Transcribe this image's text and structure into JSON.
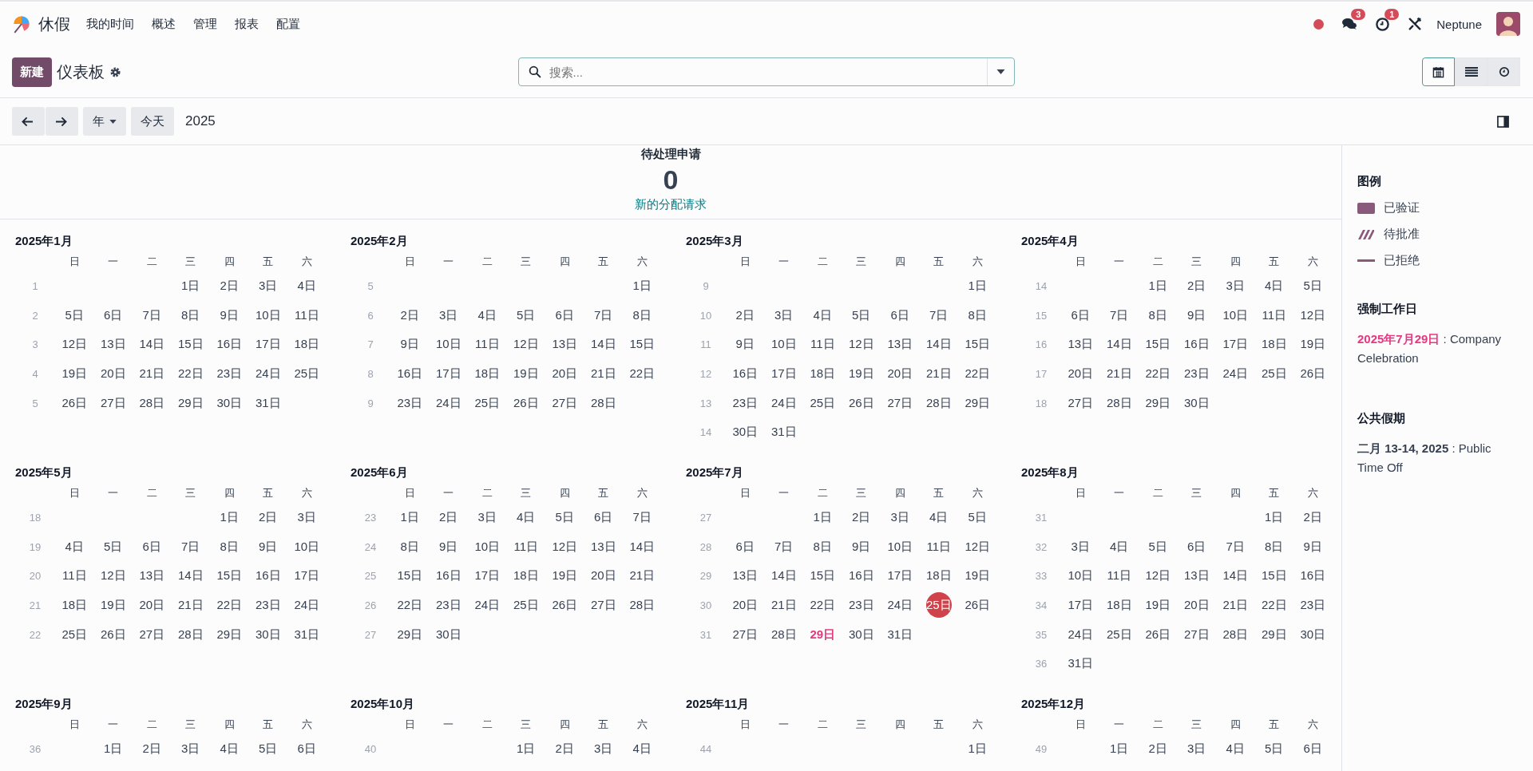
{
  "navbar": {
    "app_name": "休假",
    "menu": [
      "我的时间",
      "概述",
      "管理",
      "报表",
      "配置"
    ],
    "messages_badge": "3",
    "activities_badge": "1",
    "user_name": "Neptune"
  },
  "control_panel": {
    "new_button": "新建",
    "title": "仪表板",
    "search": {
      "placeholder": "搜索..."
    },
    "views": [
      {
        "kind": "calendar",
        "selected": true
      },
      {
        "kind": "list",
        "selected": false
      },
      {
        "kind": "activity",
        "selected": false
      }
    ]
  },
  "calendar_toolbar": {
    "scale": "年",
    "today_button": "今天",
    "period": "2025"
  },
  "pending": {
    "title": "待处理申请",
    "count": "0",
    "link": "新的分配请求"
  },
  "months": [
    {
      "title": "2025年1月",
      "weekdays": [
        "日",
        "一",
        "二",
        "三",
        "四",
        "五",
        "六"
      ],
      "weeks": [
        {
          "number": "1",
          "kind": "first",
          "days": [
            "1日",
            "2日",
            "3日",
            "4日"
          ]
        },
        {
          "number": "2",
          "kind": "full",
          "days": [
            "5日",
            "6日",
            "7日",
            "8日",
            "9日",
            "10日",
            "11日"
          ]
        },
        {
          "number": "3",
          "kind": "full",
          "days": [
            "12日",
            "13日",
            "14日",
            "15日",
            "16日",
            "17日",
            "18日"
          ]
        },
        {
          "number": "4",
          "kind": "full",
          "days": [
            "19日",
            "20日",
            "21日",
            "22日",
            "23日",
            "24日",
            "25日"
          ]
        },
        {
          "number": "5",
          "kind": "last",
          "days": [
            "26日",
            "27日",
            "28日",
            "29日",
            "30日",
            "31日"
          ]
        }
      ]
    },
    {
      "title": "2025年2月",
      "weekdays": [
        "日",
        "一",
        "二",
        "三",
        "四",
        "五",
        "六"
      ],
      "weeks": [
        {
          "number": "5",
          "kind": "first",
          "days": [
            "1日"
          ]
        },
        {
          "number": "6",
          "kind": "full",
          "days": [
            "2日",
            "3日",
            "4日",
            "5日",
            "6日",
            "7日",
            "8日"
          ]
        },
        {
          "number": "7",
          "kind": "full",
          "days": [
            "9日",
            "10日",
            "11日",
            "12日",
            "13日",
            "14日",
            "15日"
          ]
        },
        {
          "number": "8",
          "kind": "full",
          "days": [
            "16日",
            "17日",
            "18日",
            "19日",
            "20日",
            "21日",
            "22日"
          ]
        },
        {
          "number": "9",
          "kind": "last",
          "days": [
            "23日",
            "24日",
            "25日",
            "26日",
            "27日",
            "28日"
          ]
        }
      ]
    },
    {
      "title": "2025年3月",
      "weekdays": [
        "日",
        "一",
        "二",
        "三",
        "四",
        "五",
        "六"
      ],
      "weeks": [
        {
          "number": "9",
          "kind": "first",
          "days": [
            "1日"
          ]
        },
        {
          "number": "10",
          "kind": "full",
          "days": [
            "2日",
            "3日",
            "4日",
            "5日",
            "6日",
            "7日",
            "8日"
          ]
        },
        {
          "number": "11",
          "kind": "full",
          "days": [
            "9日",
            "10日",
            "11日",
            "12日",
            "13日",
            "14日",
            "15日"
          ]
        },
        {
          "number": "12",
          "kind": "full",
          "days": [
            "16日",
            "17日",
            "18日",
            "19日",
            "20日",
            "21日",
            "22日"
          ]
        },
        {
          "number": "13",
          "kind": "full",
          "days": [
            "23日",
            "24日",
            "25日",
            "26日",
            "27日",
            "28日",
            "29日"
          ]
        },
        {
          "number": "14",
          "kind": "last",
          "days": [
            "30日",
            "31日"
          ]
        }
      ]
    },
    {
      "title": "2025年4月",
      "weekdays": [
        "日",
        "一",
        "二",
        "三",
        "四",
        "五",
        "六"
      ],
      "weeks": [
        {
          "number": "14",
          "kind": "first",
          "days": [
            "1日",
            "2日",
            "3日",
            "4日",
            "5日"
          ]
        },
        {
          "number": "15",
          "kind": "full",
          "days": [
            "6日",
            "7日",
            "8日",
            "9日",
            "10日",
            "11日",
            "12日"
          ]
        },
        {
          "number": "16",
          "kind": "full",
          "days": [
            "13日",
            "14日",
            "15日",
            "16日",
            "17日",
            "18日",
            "19日"
          ]
        },
        {
          "number": "17",
          "kind": "full",
          "days": [
            "20日",
            "21日",
            "22日",
            "23日",
            "24日",
            "25日",
            "26日"
          ]
        },
        {
          "number": "18",
          "kind": "last",
          "days": [
            "27日",
            "28日",
            "29日",
            "30日"
          ]
        }
      ]
    },
    {
      "title": "2025年5月",
      "weekdays": [
        "日",
        "一",
        "二",
        "三",
        "四",
        "五",
        "六"
      ],
      "weeks": [
        {
          "number": "18",
          "kind": "first",
          "days": [
            "1日",
            "2日",
            "3日"
          ]
        },
        {
          "number": "19",
          "kind": "full",
          "days": [
            "4日",
            "5日",
            "6日",
            "7日",
            "8日",
            "9日",
            "10日"
          ]
        },
        {
          "number": "20",
          "kind": "full",
          "days": [
            "11日",
            "12日",
            "13日",
            "14日",
            "15日",
            "16日",
            "17日"
          ]
        },
        {
          "number": "21",
          "kind": "full",
          "days": [
            "18日",
            "19日",
            "20日",
            "21日",
            "22日",
            "23日",
            "24日"
          ]
        },
        {
          "number": "22",
          "kind": "full",
          "days": [
            "25日",
            "26日",
            "27日",
            "28日",
            "29日",
            "30日",
            "31日"
          ]
        }
      ]
    },
    {
      "title": "2025年6月",
      "weekdays": [
        "日",
        "一",
        "二",
        "三",
        "四",
        "五",
        "六"
      ],
      "weeks": [
        {
          "number": "23",
          "kind": "full",
          "days": [
            "1日",
            "2日",
            "3日",
            "4日",
            "5日",
            "6日",
            "7日"
          ]
        },
        {
          "number": "24",
          "kind": "full",
          "days": [
            "8日",
            "9日",
            "10日",
            "11日",
            "12日",
            "13日",
            "14日"
          ]
        },
        {
          "number": "25",
          "kind": "full",
          "days": [
            "15日",
            "16日",
            "17日",
            "18日",
            "19日",
            "20日",
            "21日"
          ]
        },
        {
          "number": "26",
          "kind": "full",
          "days": [
            "22日",
            "23日",
            "24日",
            "25日",
            "26日",
            "27日",
            "28日"
          ]
        },
        {
          "number": "27",
          "kind": "last",
          "days": [
            "29日",
            "30日"
          ]
        }
      ]
    },
    {
      "title": "2025年7月",
      "weekdays": [
        "日",
        "一",
        "二",
        "三",
        "四",
        "五",
        "六"
      ],
      "weeks": [
        {
          "number": "27",
          "kind": "first",
          "days": [
            "1日",
            "2日",
            "3日",
            "4日",
            "5日"
          ]
        },
        {
          "number": "28",
          "kind": "full",
          "days": [
            "6日",
            "7日",
            "8日",
            "9日",
            "10日",
            "11日",
            "12日"
          ]
        },
        {
          "number": "29",
          "kind": "full",
          "days": [
            "13日",
            "14日",
            "15日",
            "16日",
            "17日",
            "18日",
            "19日"
          ]
        },
        {
          "number": "30",
          "kind": "full",
          "days": [
            "20日",
            "21日",
            "22日",
            "23日",
            "24日",
            {
              "text": "25日",
              "kind": "today"
            },
            "26日"
          ]
        },
        {
          "number": "31",
          "kind": "last",
          "days": [
            "27日",
            "28日",
            {
              "text": "29日",
              "kind": "mandatory"
            },
            "30日",
            "31日"
          ]
        }
      ]
    },
    {
      "title": "2025年8月",
      "weekdays": [
        "日",
        "一",
        "二",
        "三",
        "四",
        "五",
        "六"
      ],
      "weeks": [
        {
          "number": "31",
          "kind": "first",
          "days": [
            "1日",
            "2日"
          ]
        },
        {
          "number": "32",
          "kind": "full",
          "days": [
            "3日",
            "4日",
            "5日",
            "6日",
            "7日",
            "8日",
            "9日"
          ]
        },
        {
          "number": "33",
          "kind": "full",
          "days": [
            "10日",
            "11日",
            "12日",
            "13日",
            "14日",
            "15日",
            "16日"
          ]
        },
        {
          "number": "34",
          "kind": "full",
          "days": [
            "17日",
            "18日",
            "19日",
            "20日",
            "21日",
            "22日",
            "23日"
          ]
        },
        {
          "number": "35",
          "kind": "full",
          "days": [
            "24日",
            "25日",
            "26日",
            "27日",
            "28日",
            "29日",
            "30日"
          ]
        },
        {
          "number": "36",
          "kind": "last",
          "days": [
            "31日"
          ]
        }
      ]
    },
    {
      "title": "2025年9月",
      "weekdays": [
        "日",
        "一",
        "二",
        "三",
        "四",
        "五",
        "六"
      ],
      "weeks": [
        {
          "number": "36",
          "kind": "first",
          "days": [
            "1日",
            "2日",
            "3日",
            "4日",
            "5日",
            "6日"
          ]
        }
      ]
    },
    {
      "title": "2025年10月",
      "weekdays": [
        "日",
        "一",
        "二",
        "三",
        "四",
        "五",
        "六"
      ],
      "weeks": [
        {
          "number": "40",
          "kind": "first",
          "days": [
            "1日",
            "2日",
            "3日",
            "4日"
          ]
        }
      ]
    },
    {
      "title": "2025年11月",
      "weekdays": [
        "日",
        "一",
        "二",
        "三",
        "四",
        "五",
        "六"
      ],
      "weeks": [
        {
          "number": "44",
          "kind": "first",
          "days": [
            "1日"
          ]
        }
      ]
    },
    {
      "title": "2025年12月",
      "weekdays": [
        "日",
        "一",
        "二",
        "三",
        "四",
        "五",
        "六"
      ],
      "weeks": [
        {
          "number": "49",
          "kind": "first",
          "days": [
            "1日",
            "2日",
            "3日",
            "4日",
            "5日",
            "6日"
          ]
        }
      ]
    }
  ],
  "sidebar": {
    "legend": {
      "title": "图例",
      "items": [
        {
          "kind": "solid",
          "label": "已验证"
        },
        {
          "kind": "striped",
          "label": "待批准"
        },
        {
          "kind": "line",
          "label": "已拒绝"
        }
      ]
    },
    "sections": [
      {
        "kind": "mandatory",
        "title": "强制工作日",
        "entries": [
          {
            "date": "2025年7月29日",
            "name": " : Company Celebration"
          }
        ]
      },
      {
        "kind": "holiday",
        "title": "公共假期",
        "entries": [
          {
            "date": "二月 13-14, 2025",
            "name": " : Public Time Off"
          }
        ]
      }
    ]
  }
}
